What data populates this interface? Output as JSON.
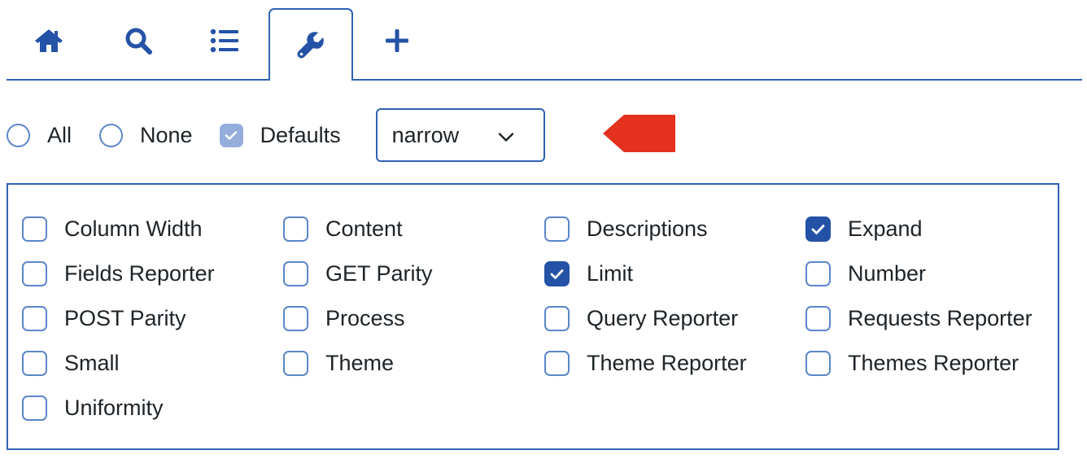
{
  "colors": {
    "accent": "#2f62b3",
    "checked_fill": "#2452a6",
    "disabled_fill": "#94addb",
    "arrow_red": "#e3311e"
  },
  "tabs": [
    {
      "icon": "home-icon",
      "active": false
    },
    {
      "icon": "search-icon",
      "active": false
    },
    {
      "icon": "list-icon",
      "active": false
    },
    {
      "icon": "wrench-icon",
      "active": true
    },
    {
      "icon": "plus-icon",
      "active": false
    }
  ],
  "options": {
    "all_label": "All",
    "none_label": "None",
    "defaults_label": "Defaults",
    "defaults_checked": true,
    "width_select": {
      "value": "narrow",
      "icon": "chevron-down-icon"
    }
  },
  "annotation": {
    "icon": "red-arrow-left-icon"
  },
  "checkbox_items": [
    {
      "label": "Column Width",
      "checked": false
    },
    {
      "label": "Content",
      "checked": false
    },
    {
      "label": "Descriptions",
      "checked": false
    },
    {
      "label": "Expand",
      "checked": true
    },
    {
      "label": "Fields Reporter",
      "checked": false
    },
    {
      "label": "GET Parity",
      "checked": false
    },
    {
      "label": "Limit",
      "checked": true
    },
    {
      "label": "Number",
      "checked": false
    },
    {
      "label": "POST Parity",
      "checked": false
    },
    {
      "label": "Process",
      "checked": false
    },
    {
      "label": "Query Reporter",
      "checked": false
    },
    {
      "label": "Requests Reporter",
      "checked": false
    },
    {
      "label": "Small",
      "checked": false
    },
    {
      "label": "Theme",
      "checked": false
    },
    {
      "label": "Theme Reporter",
      "checked": false
    },
    {
      "label": "Themes Reporter",
      "checked": false
    },
    {
      "label": "Uniformity",
      "checked": false
    }
  ]
}
